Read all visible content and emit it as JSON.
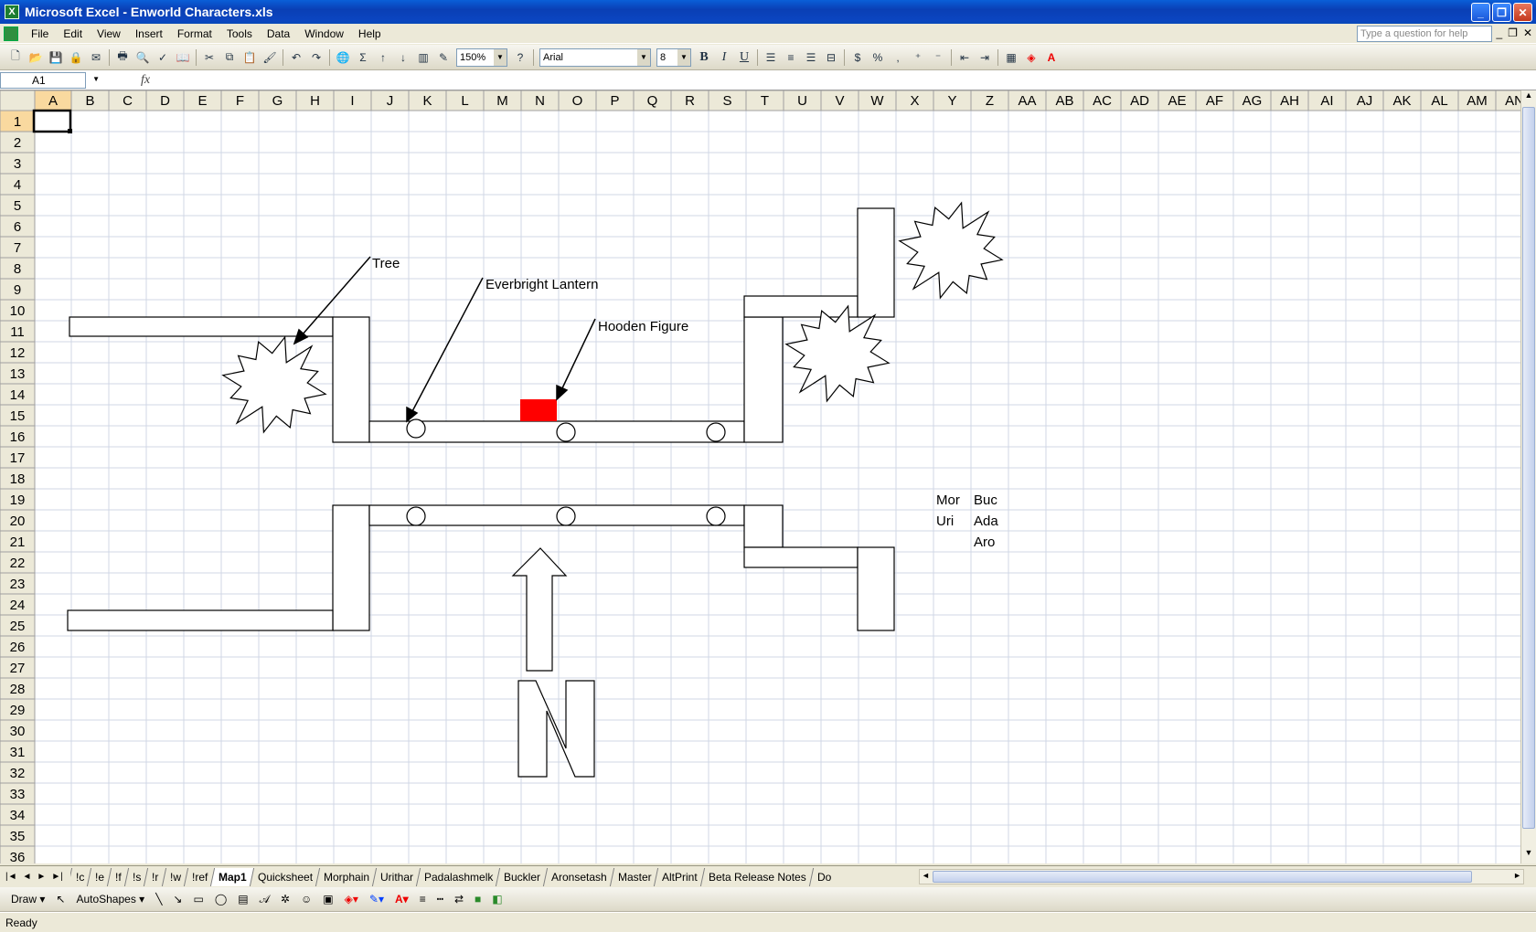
{
  "window": {
    "title": "Microsoft Excel - Enworld Characters.xls",
    "app_icon": "excel-icon",
    "buttons": [
      "minimize",
      "restore",
      "close"
    ]
  },
  "menu": {
    "items": [
      "File",
      "Edit",
      "View",
      "Insert",
      "Format",
      "Tools",
      "Data",
      "Window",
      "Help"
    ],
    "help_placeholder": "Type a question for help"
  },
  "toolbar": {
    "zoom": "150%",
    "font_name": "Arial",
    "font_size": "8",
    "bold": "B",
    "italic": "I",
    "underline": "U",
    "percent": "%",
    "comma": ","
  },
  "formula_bar": {
    "name_box": "A1",
    "fx": "fx",
    "content": ""
  },
  "sheet": {
    "columns": [
      "A",
      "B",
      "C",
      "D",
      "E",
      "F",
      "G",
      "H",
      "I",
      "J",
      "K",
      "L",
      "M",
      "N",
      "O",
      "P",
      "Q",
      "R",
      "S",
      "T",
      "U",
      "V",
      "W",
      "X",
      "Y",
      "Z",
      "AA",
      "AB",
      "AC",
      "AD",
      "AE",
      "AF",
      "AG",
      "AH",
      "AI",
      "AJ",
      "AK",
      "AL",
      "AM",
      "AN"
    ],
    "rows": [
      "1",
      "2",
      "3",
      "4",
      "5",
      "6",
      "7",
      "8",
      "9",
      "10",
      "11",
      "12",
      "13",
      "14",
      "15",
      "16",
      "17",
      "18",
      "19",
      "20",
      "21",
      "22",
      "23",
      "24",
      "25",
      "26",
      "27",
      "28",
      "29",
      "30",
      "31",
      "32",
      "33",
      "34",
      "35",
      "36"
    ],
    "selected_cell": "A1",
    "cells": [
      {
        "ref": "Y19",
        "text": "Mor"
      },
      {
        "ref": "Z19",
        "text": "Buc"
      },
      {
        "ref": "Y20",
        "text": "Uri"
      },
      {
        "ref": "Z20",
        "text": "Ada"
      },
      {
        "ref": "Z21",
        "text": "Aro"
      }
    ],
    "callouts": {
      "tree": "Tree",
      "lantern": "Everbright Lantern",
      "hooden": "Hooden Figure",
      "compass": "N"
    },
    "marker_color": "#ff0000"
  },
  "tabs": {
    "nav": [
      "|◄",
      "◄",
      "►",
      "►|"
    ],
    "items": [
      "!c",
      "!e",
      "!f",
      "!s",
      "!r",
      "!w",
      "!ref",
      "Map1",
      "Quicksheet",
      "Morphain",
      "Urithar",
      "Padalashmelk",
      "Buckler",
      "Aronsetash",
      "Master",
      "AltPrint",
      "Beta Release Notes",
      "Do"
    ],
    "active": "Map1"
  },
  "drawing": {
    "draw_label": "Draw",
    "autoshapes_label": "AutoShapes"
  },
  "status": {
    "text": "Ready"
  }
}
